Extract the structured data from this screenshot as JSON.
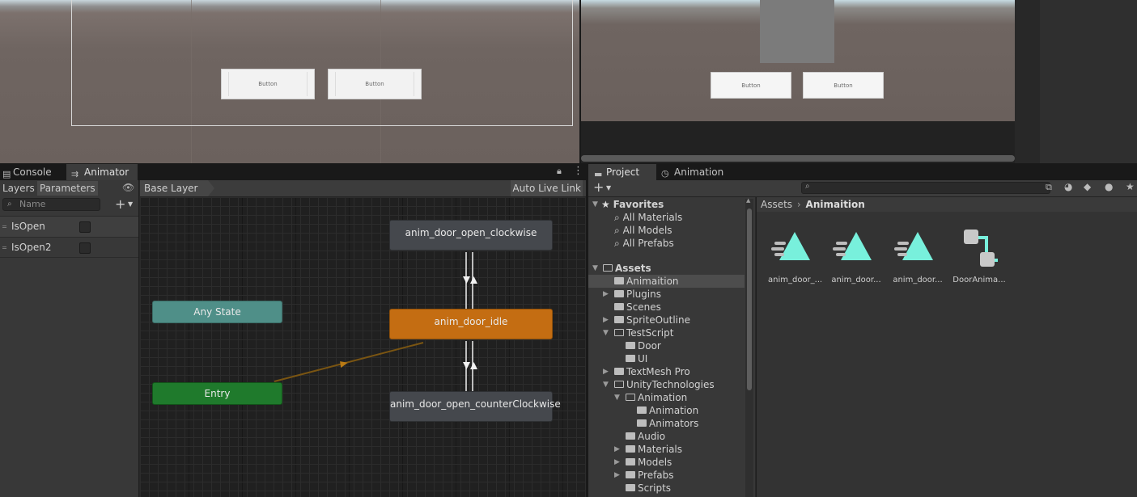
{
  "scene_view": {
    "buttons": [
      {
        "label": "Button"
      },
      {
        "label": "Button"
      }
    ]
  },
  "game_view": {
    "buttons": [
      {
        "label": "Button"
      },
      {
        "label": "Button"
      }
    ]
  },
  "left_panel": {
    "tabs": [
      {
        "label": "Console",
        "icon": "console-icon"
      },
      {
        "label": "Animator",
        "icon": "animator-icon"
      }
    ],
    "subtabs": [
      "Layers",
      "Parameters"
    ],
    "search_placeholder": "Name",
    "parameters": [
      {
        "name": "IsOpen",
        "value": false
      },
      {
        "name": "IsOpen2",
        "value": false
      }
    ],
    "breadcrumb": "Base Layer",
    "auto_live_link": "Auto Live Link",
    "states": {
      "clockwise": "anim_door_open_clockwise",
      "idle": "anim_door_idle",
      "counter": "anim_door_open_counterClockwise",
      "any_state": "Any State",
      "entry": "Entry"
    },
    "colors": {
      "default_state": "#c46d12",
      "any_state": "#4f8f88",
      "entry": "#1f7a2c"
    }
  },
  "right_panel": {
    "tabs": [
      {
        "label": "Project",
        "icon": "folder-icon"
      },
      {
        "label": "Animation",
        "icon": "clock-icon"
      }
    ],
    "favorites": {
      "label": "Favorites",
      "items": [
        "All Materials",
        "All Models",
        "All Prefabs"
      ]
    },
    "assets_root": "Assets",
    "tree": [
      {
        "label": "Animaition"
      },
      {
        "label": "Plugins"
      },
      {
        "label": "Scenes"
      },
      {
        "label": "SpriteOutline"
      },
      {
        "label": "TestScript"
      },
      {
        "label": "Door"
      },
      {
        "label": "UI"
      },
      {
        "label": "TextMesh Pro"
      },
      {
        "label": "UnityTechnologies"
      },
      {
        "label": "Animation"
      },
      {
        "label": "Animation"
      },
      {
        "label": "Animators"
      },
      {
        "label": "Audio"
      },
      {
        "label": "Materials"
      },
      {
        "label": "Models"
      },
      {
        "label": "Prefabs"
      },
      {
        "label": "Scripts"
      }
    ],
    "path": {
      "root": "Assets",
      "current": "Animaition"
    },
    "assets": [
      {
        "label": "anim_door_...",
        "icon": "animation-clip-icon"
      },
      {
        "label": "anim_door...",
        "icon": "animation-clip-icon"
      },
      {
        "label": "anim_door...",
        "icon": "animation-clip-icon"
      },
      {
        "label": "DoorAnima...",
        "icon": "animator-controller-icon"
      }
    ]
  }
}
